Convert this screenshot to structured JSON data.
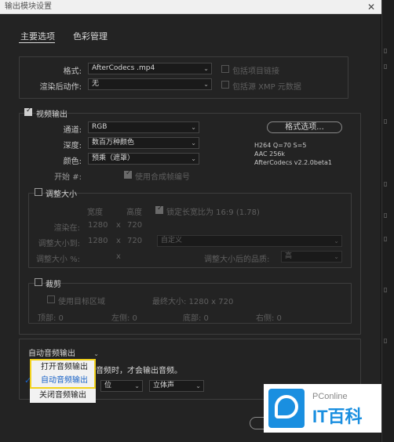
{
  "window": {
    "title": "输出模块设置",
    "close": "✕"
  },
  "tabs": [
    {
      "label": "主要选项"
    },
    {
      "label": "色彩管理"
    }
  ],
  "main": {
    "format_label": "格式:",
    "format_value": "AfterCodecs .mp4",
    "include_project_link": "包括项目链接",
    "post_render_label": "渲染后动作:",
    "post_render_value": "无",
    "include_xmp": "包括源 XMP 元数据"
  },
  "video": {
    "title": "视频输出",
    "channel_label": "通道:",
    "channel_value": "RGB",
    "depth_label": "深度:",
    "depth_value": "数百万种颜色",
    "color_label": "颜色:",
    "color_value": "预乘（遮罩）",
    "start_label": "开始 #:",
    "use_comp_frame": "使用合成帧编号",
    "format_options_button": "格式选项...",
    "info_lines": [
      "H264 Q=70 S=5",
      "AAC 256k",
      "AfterCodecs v2.2.0beta1"
    ]
  },
  "resize": {
    "title": "调整大小",
    "width_header": "宽度",
    "height_header": "高度",
    "lock_aspect": "锁定长宽比为 16:9 (1.78)",
    "render_at_label": "渲染在:",
    "render_w": "1280",
    "render_h": "720",
    "resize_to_label": "调整大小到:",
    "resize_to_w": "1280",
    "resize_to_h": "720",
    "resize_preset": "自定义",
    "resize_pct_label": "调整大小 %:",
    "x": "x",
    "quality_label": "调整大小后的品质:",
    "quality_value": "高"
  },
  "crop": {
    "title": "裁剪",
    "use_region": "使用目标区域",
    "final_size": "最终大小: 1280 x 720",
    "top": "顶部: 0",
    "left": "左侧: 0",
    "bottom": "底部: 0",
    "right": "右侧: 0"
  },
  "audio": {
    "mode_value": "自动音频输出",
    "note": "音频时，才会输出音频。",
    "bits_value": "位",
    "channels_value": "立体声",
    "menu": [
      {
        "label": "打开音频输出",
        "selected": false
      },
      {
        "label": "自动音频输出",
        "selected": true
      },
      {
        "label": "关闭音频输出",
        "selected": false
      }
    ],
    "check": "✓"
  },
  "watermark": {
    "brand_small": "PConline",
    "brand_big": "IT百科"
  },
  "colors": {
    "highlight_border": "#f2d21b",
    "selected_text": "#1a63c7",
    "logo_blue": "#1a8fe0"
  }
}
